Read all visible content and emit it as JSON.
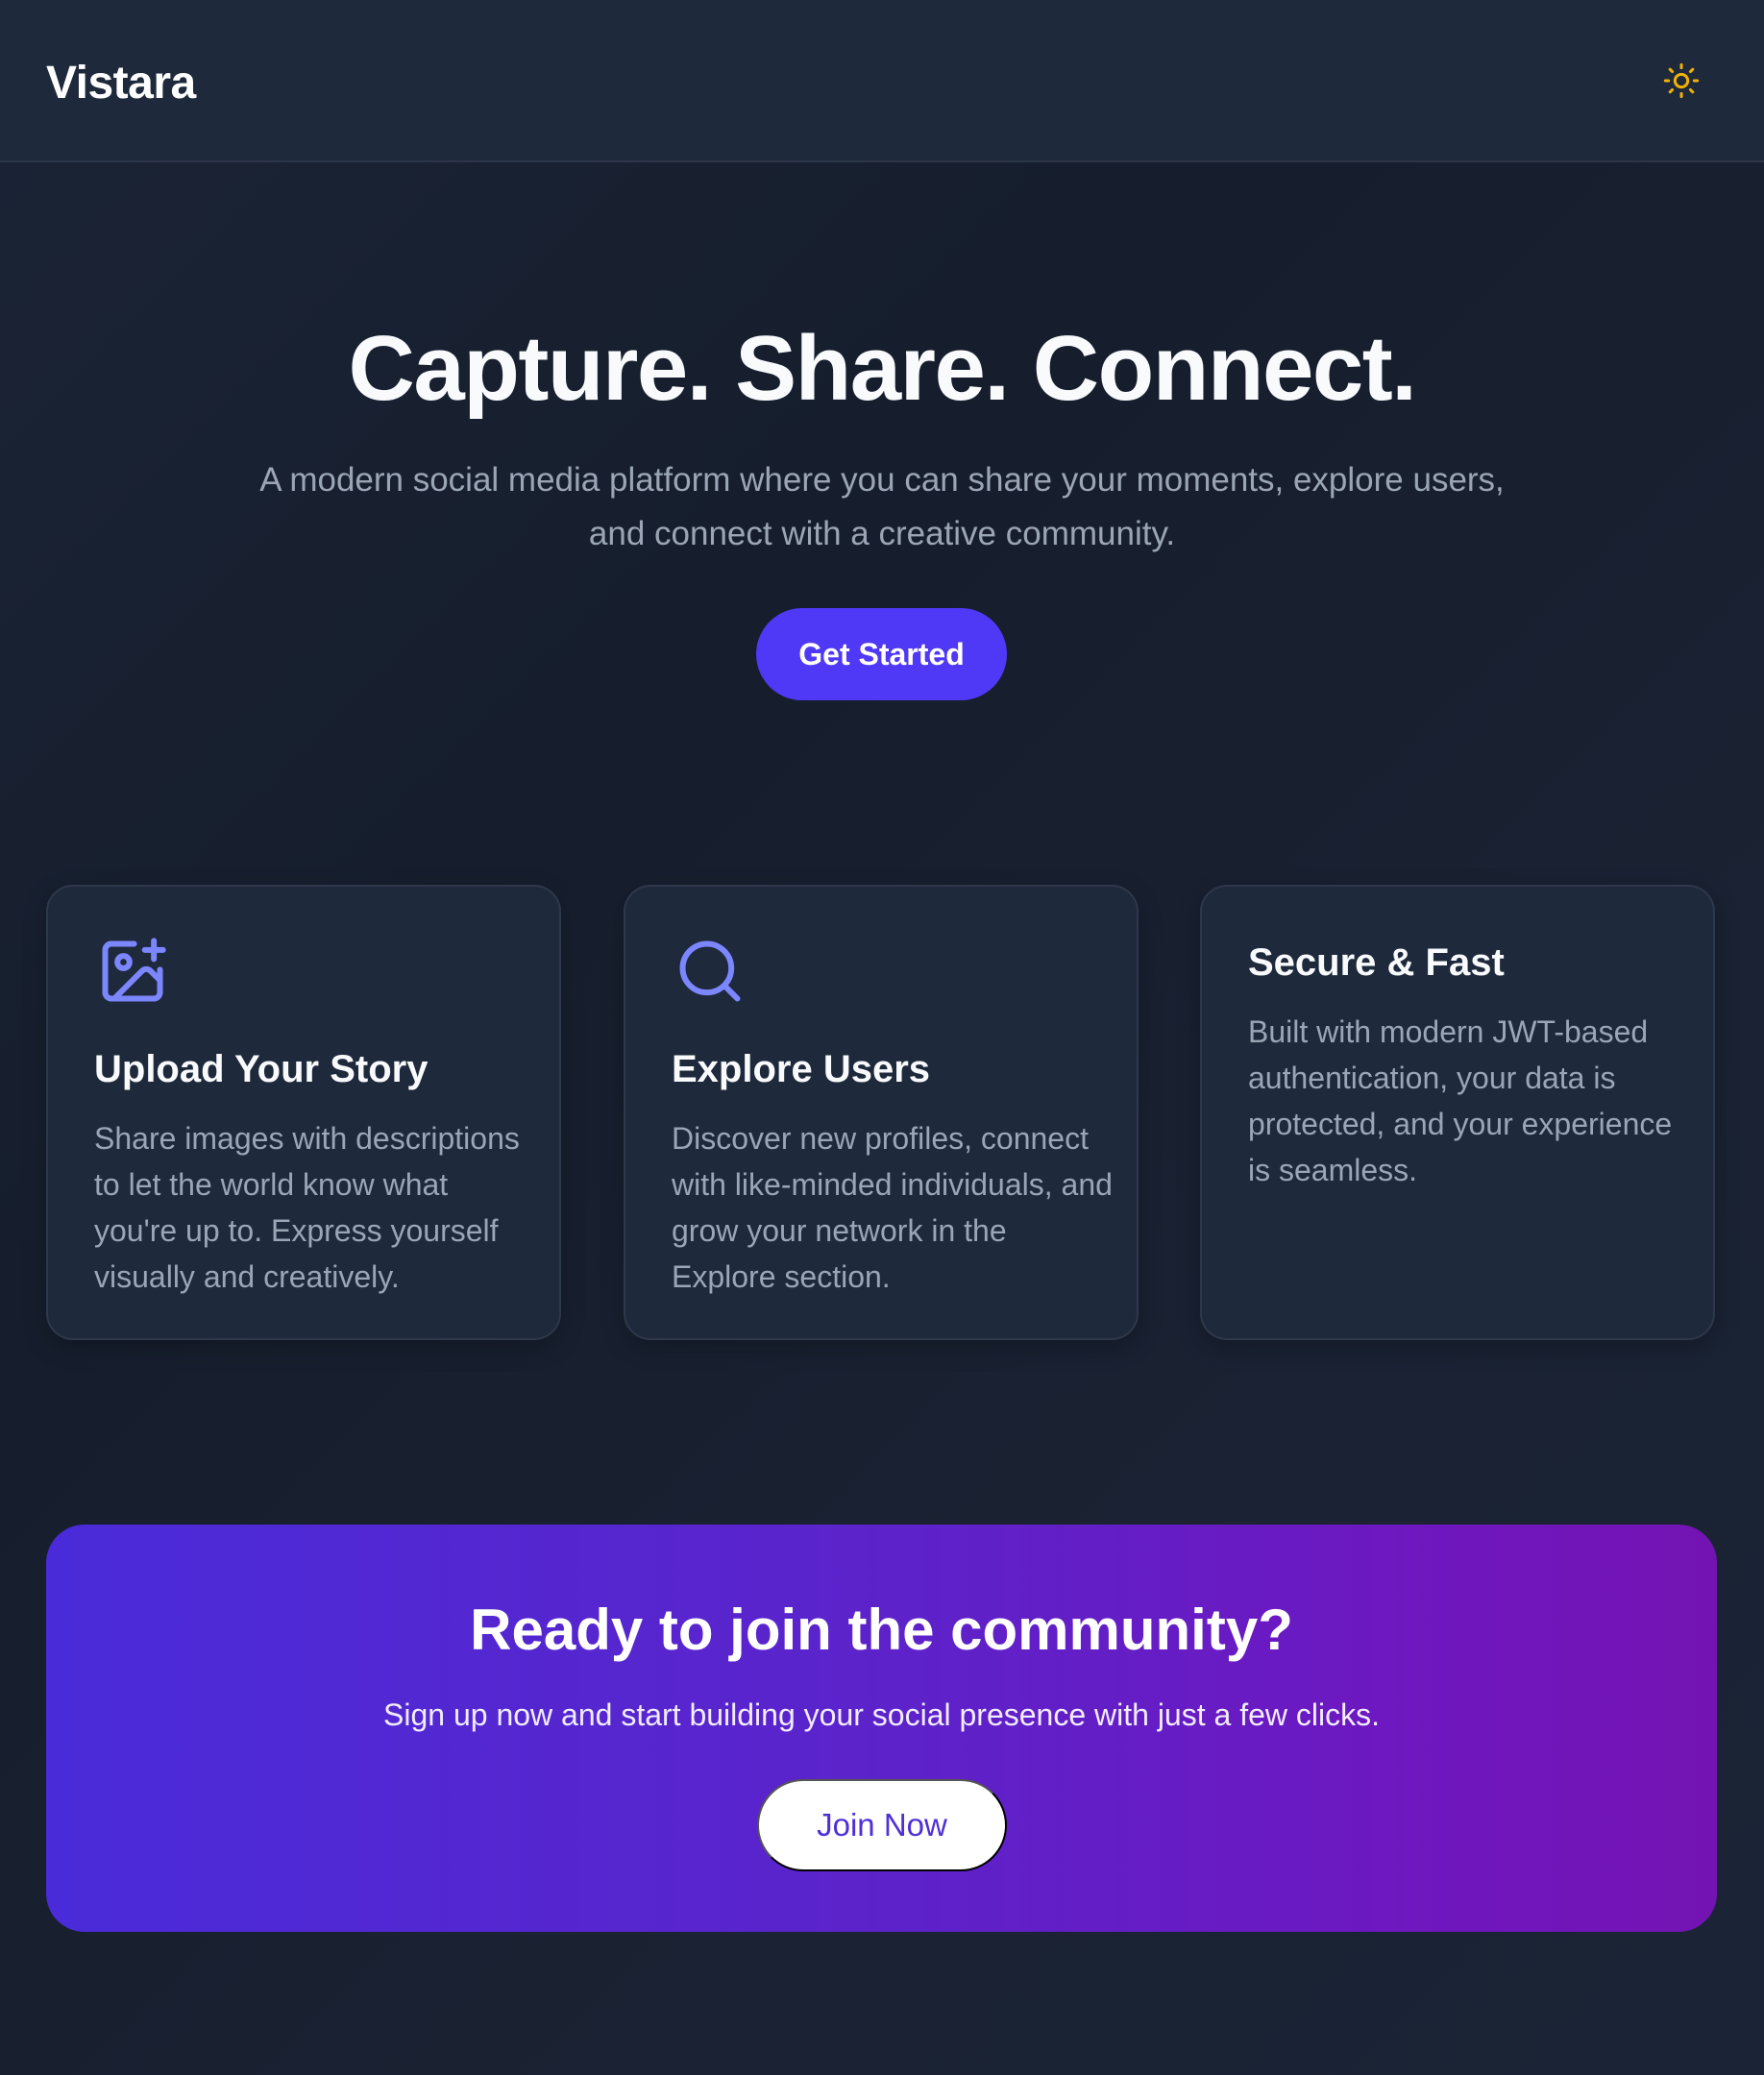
{
  "header": {
    "brand": "Vistara",
    "theme_toggle_icon": "sun-icon"
  },
  "hero": {
    "title": "Capture. Share. Connect.",
    "subtitle": "A modern social media platform where you can share your moments, explore users, and connect with a creative community.",
    "cta_label": "Get Started"
  },
  "features": [
    {
      "icon": "image-plus-icon",
      "title": "Upload Your Story",
      "text": "Share images with descriptions to let the world know what you're up to. Express yourself visually and creatively."
    },
    {
      "icon": "search-icon",
      "title": "Explore Users",
      "text": "Discover new profiles, connect with like-minded individuals, and grow your network in the Explore section."
    },
    {
      "title": "Secure & Fast",
      "text": "Built with modern JWT-based authentication, your data is protected, and your experience is seamless."
    }
  ],
  "cta": {
    "title": "Ready to join the community?",
    "subtitle": "Sign up now and start building your social presence with just a few clicks.",
    "button_label": "Join Now"
  },
  "colors": {
    "background": "#182030",
    "header": "#1e293b",
    "card": "#1e293b",
    "accent": "#4f39f6",
    "icon": "#7c86ff",
    "sun": "#f0b100",
    "cta_start": "#4a2bd9",
    "cta_end": "#7413b3"
  }
}
